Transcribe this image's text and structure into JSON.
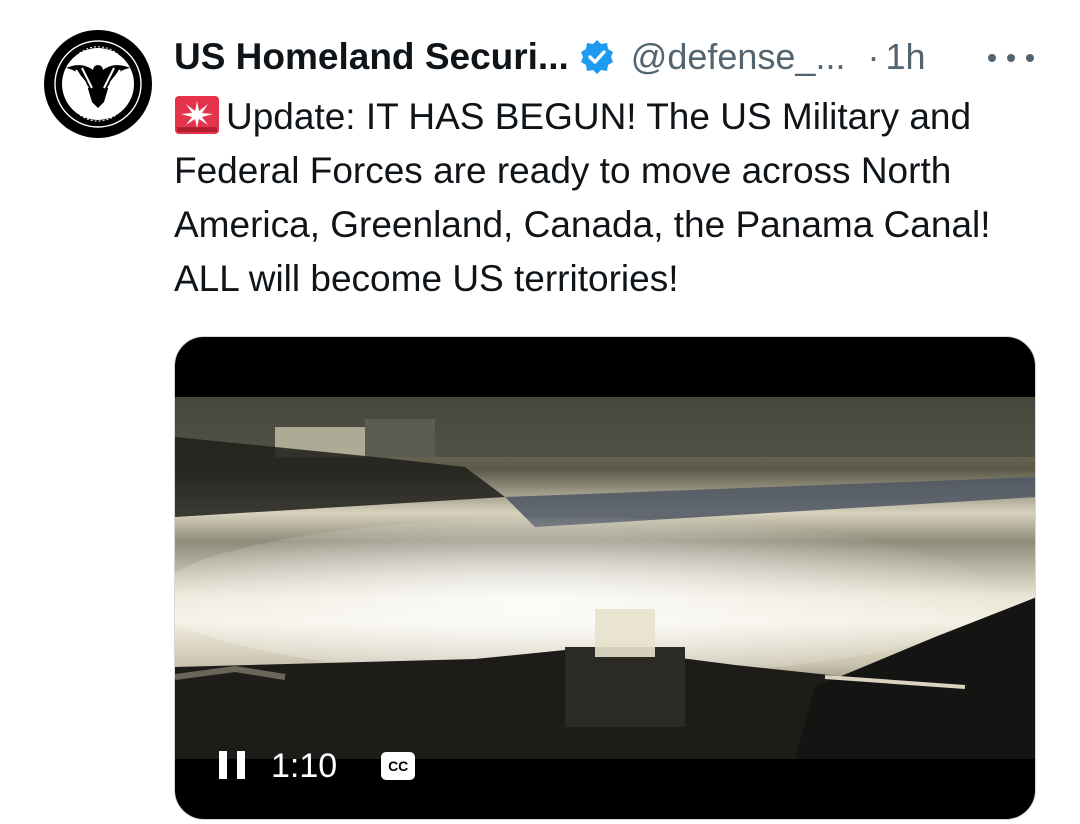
{
  "author": {
    "display_name": "US Homeland Securi...",
    "handle": "@defense_...",
    "separator": "·",
    "time": "1h",
    "verified": true,
    "verified_color": "#1d9bf0",
    "avatar_icon": "shield-eagle-logo-icon",
    "avatar_logo_text": "STRATEGIC HOMELAND INTERVENTION ENFORCEMENT AND LOGISTICS DIVISION"
  },
  "tweet": {
    "emoji_icon": "police-siren-icon",
    "text": "Update: IT HAS BEGUN! The US Military and Federal Forces are ready to move across North America, Greenland, Canada, the Panama Canal! ALL will become US territories!"
  },
  "video": {
    "state": "playing",
    "control_icon": "pause-icon",
    "time": "1:10",
    "captions_label": "CC"
  },
  "more_icon": "more-options-icon",
  "colors": {
    "text_primary": "#0f1419",
    "text_secondary": "#536471",
    "border": "#cfd9de",
    "accent": "#1d9bf0"
  }
}
